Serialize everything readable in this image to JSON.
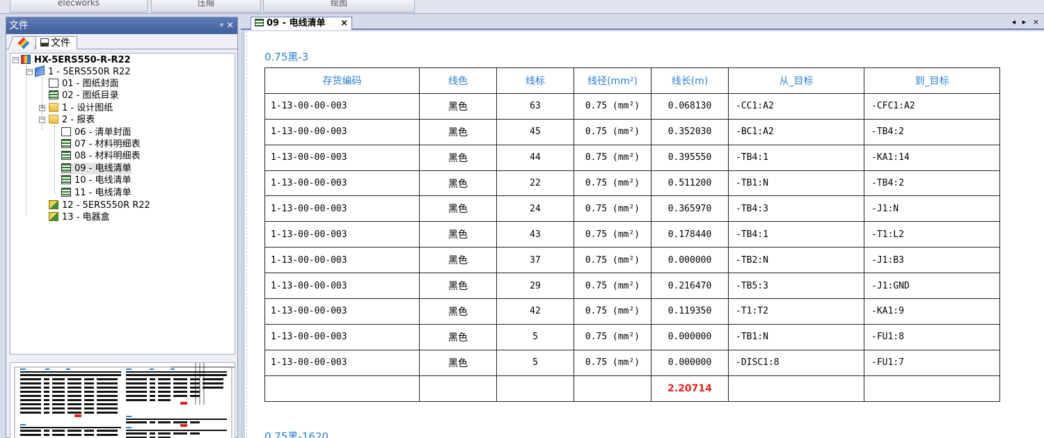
{
  "ribbon": {
    "groups": [
      "elecworks",
      "压缩",
      "绘图"
    ]
  },
  "left_panel": {
    "title": "文件",
    "pin": "ᵠ",
    "close": "×",
    "tab_label": "文件",
    "tree": [
      {
        "label": "HX-5ERS550-R-R22",
        "icon": "project-icon",
        "bold": true
      },
      {
        "label": "1 - 5ERS550R R22",
        "icon": "book-icon"
      },
      {
        "label": "01 - 图纸封面",
        "icon": "drawing-icon"
      },
      {
        "label": "02 - 图纸目录",
        "icon": "sheet-icon"
      },
      {
        "label": "1 - 设计图纸",
        "icon": "folder-icon"
      },
      {
        "label": "2 - 报表",
        "icon": "folder-icon"
      },
      {
        "label": "06 - 清单封面",
        "icon": "drawing-icon"
      },
      {
        "label": "07 - 材料明细表",
        "icon": "sheet-icon"
      },
      {
        "label": "08 - 材料明细表",
        "icon": "sheet-icon"
      },
      {
        "label": "09 - 电线清单",
        "icon": "sheet-icon"
      },
      {
        "label": "10 - 电线清单",
        "icon": "sheet-icon"
      },
      {
        "label": "11 - 电线清单",
        "icon": "sheet-icon"
      },
      {
        "label": "12 - 5ERS550R R22",
        "icon": "box-icon"
      },
      {
        "label": "13 - 电器盒",
        "icon": "box-icon"
      }
    ]
  },
  "document": {
    "tab_label": "09 - 电线清单",
    "tab_close": "×",
    "nav": "◂ ▸ ×",
    "section_title": "0.75黑-3",
    "next_section_title": "0.75黑-1620",
    "table": {
      "headers": [
        "存货编码",
        "线色",
        "线标",
        "线径(mm²)",
        "线长(m)",
        "从_目标",
        "到_目标"
      ],
      "rows": [
        [
          "1-13-00-00-003",
          "黑色",
          "63",
          "0.75 (mm²)",
          "0.068130",
          "-CC1:A2",
          "-CFC1:A2"
        ],
        [
          "1-13-00-00-003",
          "黑色",
          "45",
          "0.75 (mm²)",
          "0.352030",
          "-BC1:A2",
          "-TB4:2"
        ],
        [
          "1-13-00-00-003",
          "黑色",
          "44",
          "0.75 (mm²)",
          "0.395550",
          "-TB4:1",
          "-KA1:14"
        ],
        [
          "1-13-00-00-003",
          "黑色",
          "22",
          "0.75 (mm²)",
          "0.511200",
          "-TB1:N",
          "-TB4:2"
        ],
        [
          "1-13-00-00-003",
          "黑色",
          "24",
          "0.75 (mm²)",
          "0.365970",
          "-TB4:3",
          "-J1:N"
        ],
        [
          "1-13-00-00-003",
          "黑色",
          "43",
          "0.75 (mm²)",
          "0.178440",
          "-TB4:1",
          "-T1:L2"
        ],
        [
          "1-13-00-00-003",
          "黑色",
          "37",
          "0.75 (mm²)",
          "0.000000",
          "-TB2:N",
          "-J1:B3"
        ],
        [
          "1-13-00-00-003",
          "黑色",
          "29",
          "0.75 (mm²)",
          "0.216470",
          "-TB5:3",
          "-J1:GND"
        ],
        [
          "1-13-00-00-003",
          "黑色",
          "42",
          "0.75 (mm²)",
          "0.119350",
          "-T1:T2",
          "-KA1:9"
        ],
        [
          "1-13-00-00-003",
          "黑色",
          "5",
          "0.75 (mm²)",
          "0.000000",
          "-TB1:N",
          "-FU1:8"
        ],
        [
          "1-13-00-00-003",
          "黑色",
          "5",
          "0.75 (mm²)",
          "0.000000",
          "-DISC1:8",
          "-FU1:7"
        ]
      ],
      "total": "2.20714"
    }
  },
  "colors": {
    "accent": "#2a7fd4",
    "total": "#e0231f",
    "title_bar": "#4a6aa8"
  }
}
